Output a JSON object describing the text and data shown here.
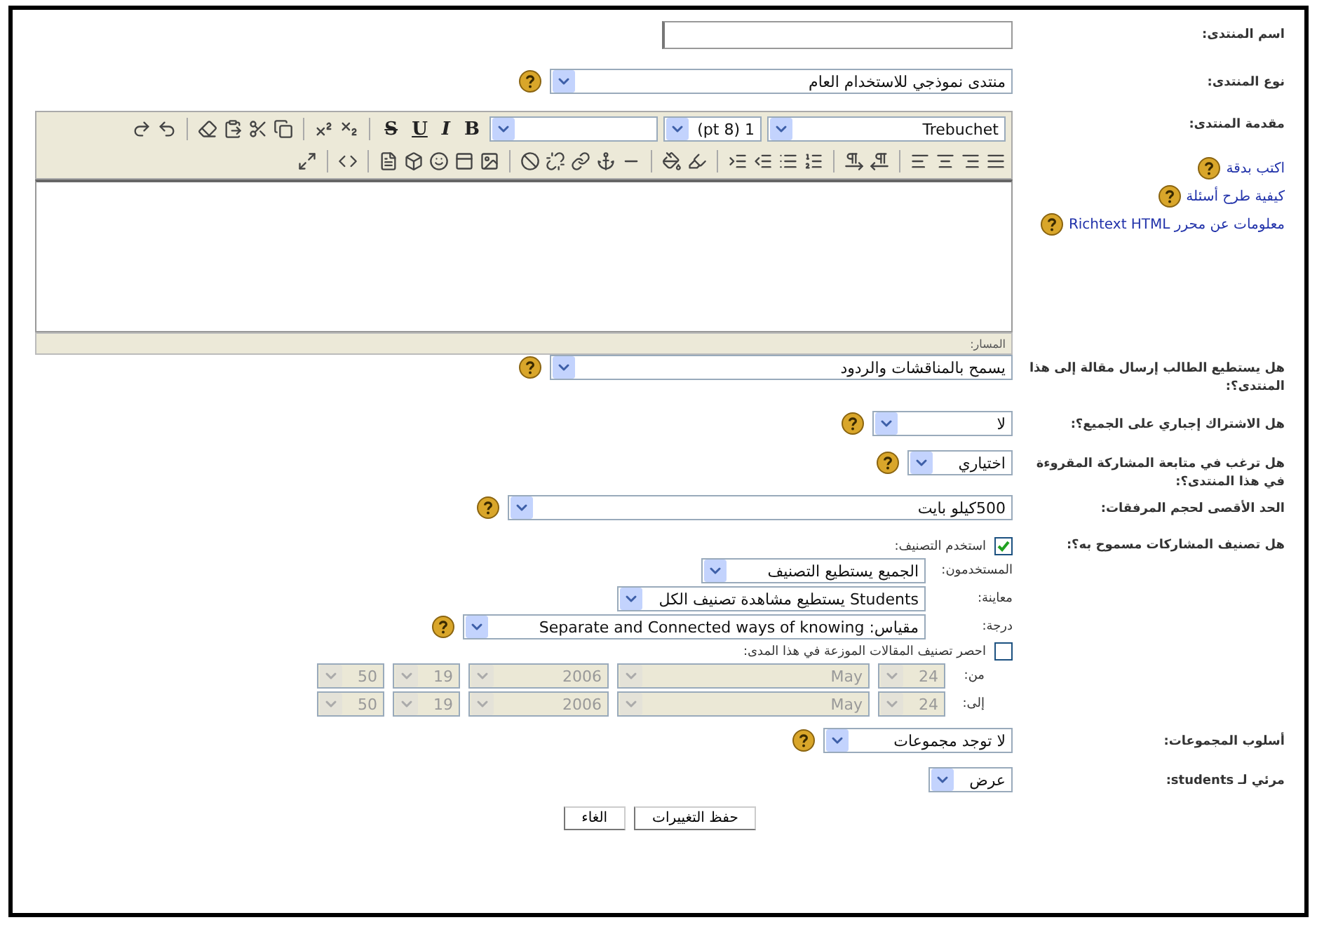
{
  "fields": [
    {
      "kind": "text",
      "label": "اسم المنتدى:"
    },
    {
      "kind": "select",
      "label": "نوع المنتدى:",
      "value": "منتدى نموذجي للاستخدام العام",
      "help": true
    },
    {
      "kind": "editor",
      "label": "مقدمة المنتدى:",
      "links": [
        "اكتب بدقة",
        "كيفية طرح أسئلة",
        "معلومات عن محرر Richtext HTML"
      ],
      "font": "Trebuchet",
      "size": "1 (8 pt)",
      "format_buttons": [
        "B",
        "I",
        "U",
        "S"
      ],
      "path_label": "المسار:"
    },
    {
      "kind": "select",
      "label": "هل يستطيع الطالب إرسال مقالة إلى هذا المنتدى؟:",
      "value": "يسمح بالمناقشات والردود",
      "help": true
    },
    {
      "kind": "select",
      "label": "هل الاشتراك إجباري على الجميع؟:",
      "value": "لا",
      "help": true
    },
    {
      "kind": "select",
      "label": "هل ترغب في متابعة المشاركة المقروءة في هذا المنتدى؟:",
      "value": "اختياري",
      "help": true
    },
    {
      "kind": "select",
      "label": "الحد الأقصى لحجم المرفقات:",
      "value": "500كيلو بايت",
      "help": true
    },
    {
      "kind": "rating",
      "label": "هل تصنيف المشاركات مسموح به؟:",
      "use_label": "استخدم التصنيف:",
      "use_checked": true,
      "options": [
        {
          "label": "المستخدمون:",
          "value": "الجميع يستطيع التصنيف",
          "help": false
        },
        {
          "label": "معاينة:",
          "value": "Students يستطيع مشاهدة تصنيف الكل",
          "help": false
        },
        {
          "label": "درجة:",
          "value": "مقياس: Separate and Connected ways of knowing",
          "help": true
        }
      ],
      "restrict_label": "احصر تصنيف المقالات الموزعة في هذا المدى:",
      "restrict_checked": false,
      "dates": [
        {
          "label": "من:",
          "parts": [
            "24",
            "May",
            "2006",
            "19",
            "50"
          ],
          "disabled": true
        },
        {
          "label": "إلى:",
          "parts": [
            "24",
            "May",
            "2006",
            "19",
            "50"
          ],
          "disabled": true
        }
      ]
    },
    {
      "kind": "select",
      "label": "أسلوب المجموعات:",
      "value": "لا توجد مجموعات",
      "help": true
    },
    {
      "kind": "select",
      "label": "مرئي لـ students:",
      "value": "عرض",
      "help": false
    }
  ],
  "buttons": [
    "حفظ التغييرات",
    "الغاء"
  ]
}
